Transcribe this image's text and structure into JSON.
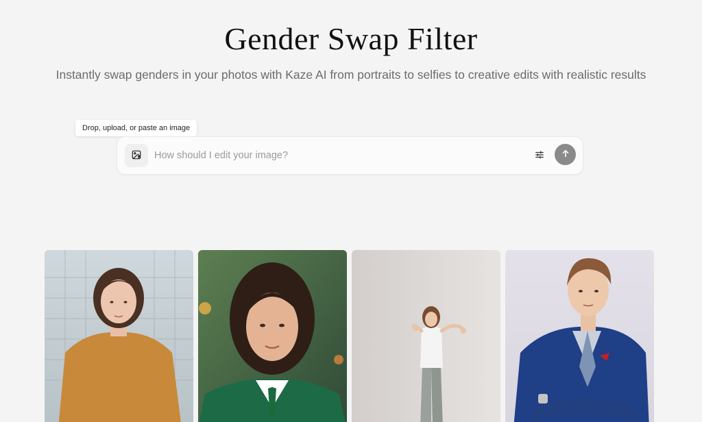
{
  "hero": {
    "title": "Gender Swap Filter",
    "subtitle": "Instantly swap genders in your photos with Kaze AI from portraits to selfies to creative edits with realistic results"
  },
  "upload": {
    "tooltip": "Drop, upload, or paste an image",
    "icon": "image-upload-icon"
  },
  "prompt": {
    "placeholder": "How should I edit your image?",
    "settings_icon": "sliders-icon",
    "send_icon": "arrow-up-icon"
  },
  "gallery": {
    "items": [
      {
        "subject": "woman-mustard-tshirt"
      },
      {
        "subject": "woman-green-blazer"
      },
      {
        "subject": "woman-peace-sign"
      },
      {
        "subject": "man-blue-suit"
      }
    ]
  },
  "colors": {
    "background": "#f4f4f4",
    "send_button": "#8a8a8a",
    "subtitle": "#6b6b6b"
  }
}
